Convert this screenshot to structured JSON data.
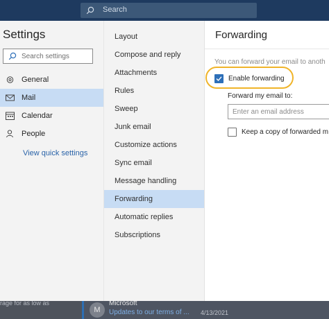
{
  "topbar": {
    "search_placeholder": "Search"
  },
  "settings": {
    "title": "Settings",
    "search_placeholder": "Search settings",
    "nav": [
      {
        "label": "General",
        "icon": "gear-icon",
        "active": false
      },
      {
        "label": "Mail",
        "icon": "mail-icon",
        "active": true
      },
      {
        "label": "Calendar",
        "icon": "calendar-icon",
        "active": false
      },
      {
        "label": "People",
        "icon": "people-icon",
        "active": false
      }
    ],
    "quick_settings_link": "View quick settings"
  },
  "mail_subnav": {
    "items": [
      "Layout",
      "Compose and reply",
      "Attachments",
      "Rules",
      "Sweep",
      "Junk email",
      "Customize actions",
      "Sync email",
      "Message handling",
      "Forwarding",
      "Automatic replies",
      "Subscriptions"
    ],
    "active": "Forwarding"
  },
  "forwarding": {
    "title": "Forwarding",
    "description": "You can forward your email to anoth",
    "enable_label": "Enable forwarding",
    "enable_checked": true,
    "forward_to_label": "Forward my email to:",
    "email_placeholder": "Enter an email address",
    "keep_copy_label": "Keep a copy of forwarded m",
    "keep_copy_checked": false,
    "highlight_color": "#f0b429"
  },
  "background": {
    "left_snippet": "rage for as low as",
    "sender": "Microsoft",
    "subject": "Updates to our terms of ...",
    "date": "4/13/2021",
    "avatar_letter": "M"
  },
  "colors": {
    "accent": "#2d6fb8",
    "active_item_bg": "#c7dcf4",
    "link": "#2a63a8",
    "topbar": "#1e3a5f"
  }
}
